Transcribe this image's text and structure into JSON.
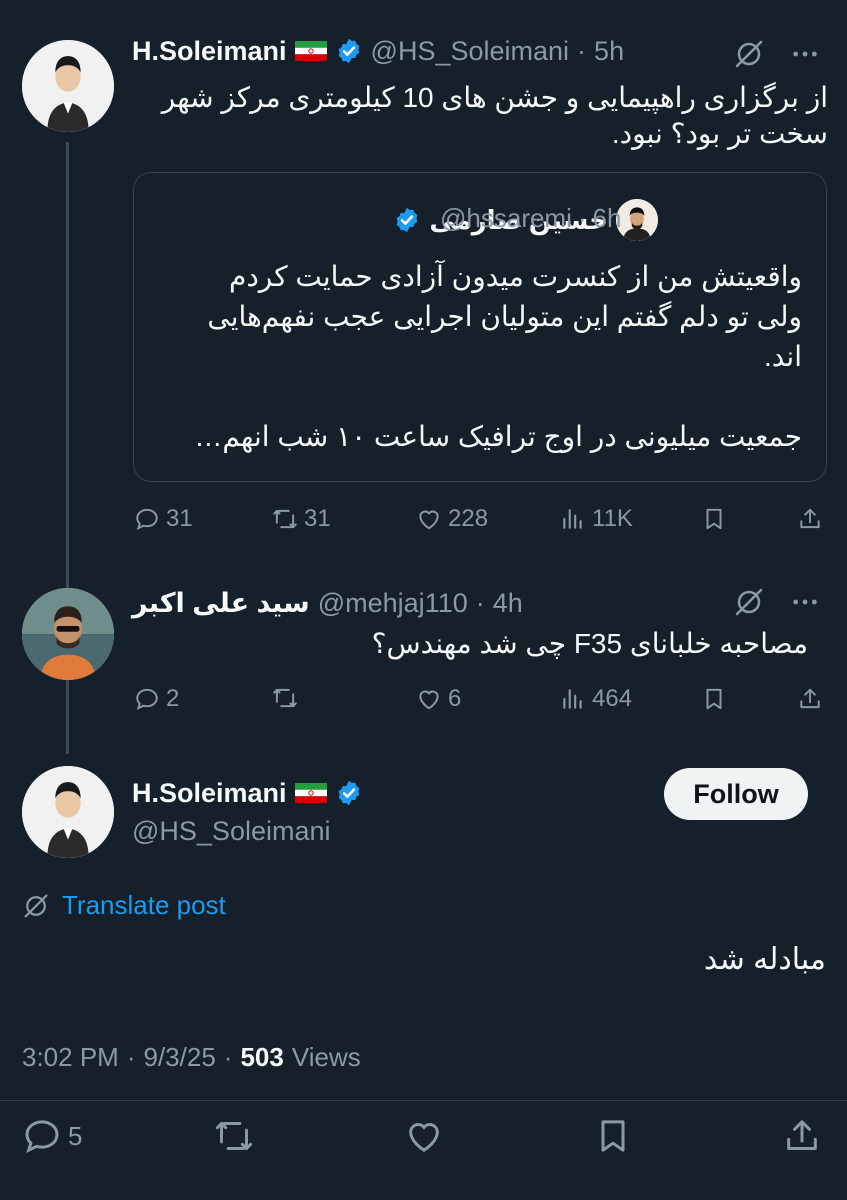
{
  "thread": {
    "post1": {
      "display_name": "H.Soleimani",
      "handle": "@HS_Soleimani",
      "time": "5h",
      "dot": "·",
      "text": "از برگزاری راهپیمایی و جشن های 10 کیلومتری مرکز شهر سخت تر بود؟ نبود.",
      "quote": {
        "display_name": "حسین صارمی",
        "handle": "@hssaremi",
        "time": "6h",
        "text1": "واقعیتش من از کنسرت میدون آزادی حمایت کردم ولی تو دلم گفتم این متولیان اجرایی عجب نفهم‌هایی اند.",
        "text2": "جمعیت میلیونی در اوج ترافیک ساعت ۱۰ شب انهم…"
      },
      "stats": {
        "replies": "31",
        "reposts": "31",
        "likes": "228",
        "views": "11K"
      }
    },
    "post2": {
      "display_name": "سید علی اکبر",
      "handle": "@mehjaj110",
      "time": "4h",
      "text": "مصاحبه خلبانای F35 چی شد مهندس؟",
      "stats": {
        "replies": "2",
        "reposts": "",
        "likes": "6",
        "views": "464"
      }
    }
  },
  "main": {
    "display_name": "H.Soleimani",
    "handle": "@HS_Soleimani",
    "follow_label": "Follow",
    "translate_label": "Translate post",
    "text": "مبادله شد",
    "time": "3:02 PM",
    "date": "9/3/25",
    "views_count": "503",
    "views_label": "Views",
    "stats": {
      "replies": "5"
    }
  },
  "colors": {
    "background": "#15202b",
    "accent": "#1d9bf0",
    "muted": "#8b98a5",
    "text": "#f7f9f9"
  },
  "icons": [
    "reply-icon",
    "repost-icon",
    "like-icon",
    "views-icon",
    "bookmark-icon",
    "share-icon",
    "grok-icon",
    "more-icon",
    "verified-icon",
    "translate-icon",
    "iran-flag-icon"
  ]
}
